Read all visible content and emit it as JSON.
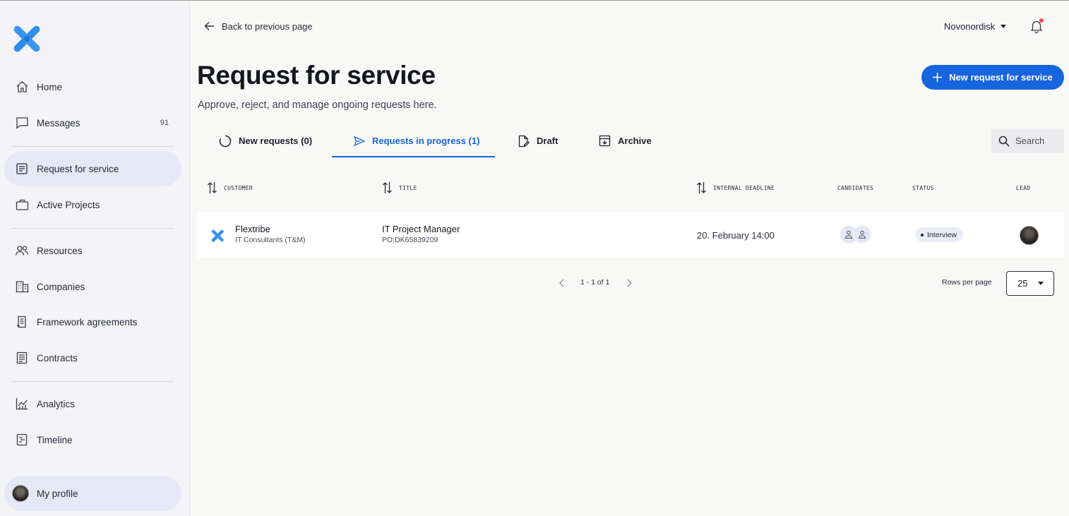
{
  "sidebar": {
    "items": [
      {
        "label": "Home",
        "icon": "home-icon"
      },
      {
        "label": "Messages",
        "icon": "message-icon",
        "badge": "91"
      },
      {
        "label": "Request for service",
        "icon": "request-icon",
        "active": true
      },
      {
        "label": "Active Projects",
        "icon": "briefcase-icon"
      },
      {
        "label": "Resources",
        "icon": "people-icon"
      },
      {
        "label": "Companies",
        "icon": "building-icon"
      },
      {
        "label": "Framework agreements",
        "icon": "agreement-icon"
      },
      {
        "label": "Contracts",
        "icon": "contract-icon"
      },
      {
        "label": "Analytics",
        "icon": "analytics-icon"
      },
      {
        "label": "Timeline",
        "icon": "timeline-icon"
      }
    ],
    "profile_label": "My profile"
  },
  "header": {
    "back_label": "Back to previous page",
    "org_name": "Novonordisk",
    "notification_dot": true
  },
  "page": {
    "title": "Request for service",
    "subtitle": "Approve, reject, and manage ongoing requests here.",
    "new_button_label": "New request for service"
  },
  "tabs": [
    {
      "label": "New requests (0)",
      "icon": "spinner-icon"
    },
    {
      "label": "Requests in progress (1)",
      "icon": "send-icon",
      "active": true
    },
    {
      "label": "Draft",
      "icon": "draft-icon"
    },
    {
      "label": "Archive",
      "icon": "archive-icon"
    }
  ],
  "search": {
    "placeholder": "Search"
  },
  "table": {
    "columns": [
      "Customer",
      "Title",
      "Internal deadline",
      "Candidates",
      "Status",
      "Lead"
    ],
    "rows": [
      {
        "customer_name": "Flextribe",
        "customer_sub": "IT Consultants (T&M)",
        "title": "IT Project Manager",
        "title_sub": "PO;DK65839209",
        "deadline": "20. February 14:00",
        "candidates": 2,
        "status": "Interview"
      }
    ]
  },
  "pagination": {
    "range": "1 - 1 of 1",
    "rows_per_page_label": "Rows per page",
    "rows_per_page_value": "25"
  },
  "colors": {
    "accent": "#1764df",
    "logo": "#2f8fee",
    "active_nav": "#e7e8f7",
    "notification": "#ef4a4a"
  }
}
